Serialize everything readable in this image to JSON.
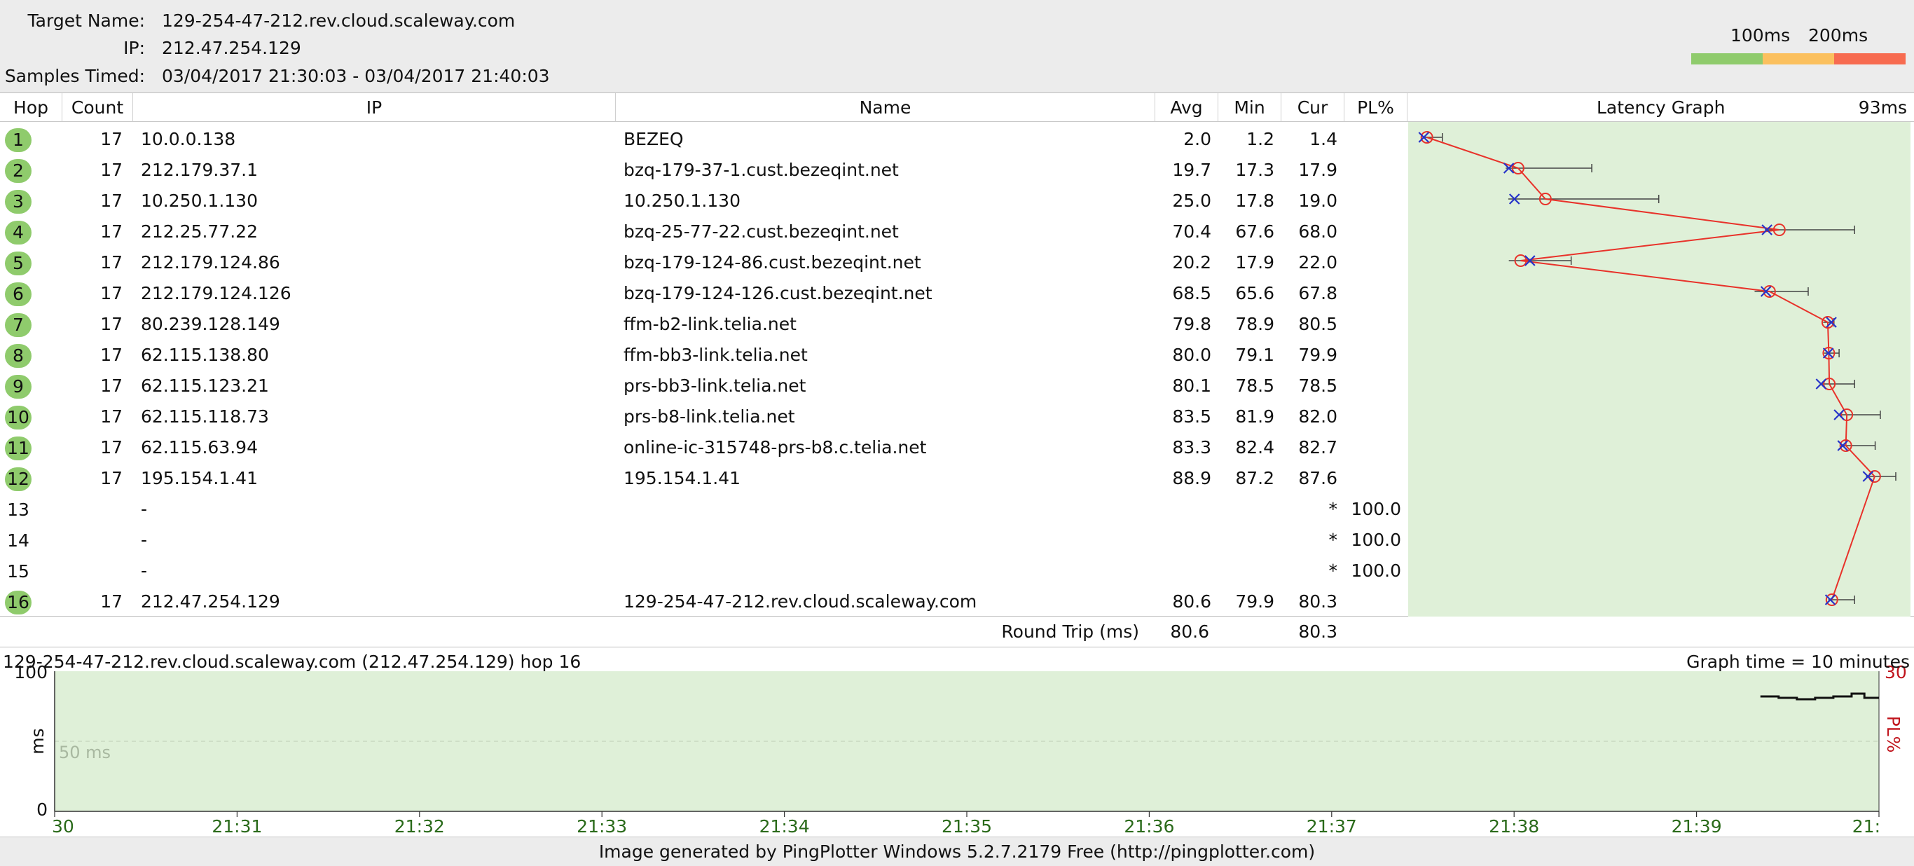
{
  "header": {
    "target_label": "Target Name:",
    "target_value": "129-254-47-212.rev.cloud.scaleway.com",
    "ip_label": "IP:",
    "ip_value": "212.47.254.129",
    "samples_label": "Samples Timed:",
    "samples_value": "03/04/2017 21:30:03 - 03/04/2017 21:40:03"
  },
  "legend": {
    "label_100": "100ms",
    "label_200": "200ms",
    "colors": [
      "#8fcb6c",
      "#fbc05e",
      "#f76b50"
    ]
  },
  "table": {
    "columns": {
      "hop": "Hop",
      "count": "Count",
      "ip": "IP",
      "name": "Name",
      "avg": "Avg",
      "min": "Min",
      "cur": "Cur",
      "pl": "PL%",
      "graph": "Latency Graph",
      "graph_scale": "93ms"
    },
    "rows": [
      {
        "hop": "1",
        "count": "17",
        "ip": "10.0.0.138",
        "name": "BEZEQ",
        "avg": "2.0",
        "min": "1.2",
        "cur": "1.4",
        "pl": "",
        "ok": true
      },
      {
        "hop": "2",
        "count": "17",
        "ip": "212.179.37.1",
        "name": "bzq-179-37-1.cust.bezeqint.net",
        "avg": "19.7",
        "min": "17.3",
        "cur": "17.9",
        "pl": "",
        "ok": true
      },
      {
        "hop": "3",
        "count": "17",
        "ip": "10.250.1.130",
        "name": "10.250.1.130",
        "avg": "25.0",
        "min": "17.8",
        "cur": "19.0",
        "pl": "",
        "ok": true
      },
      {
        "hop": "4",
        "count": "17",
        "ip": "212.25.77.22",
        "name": "bzq-25-77-22.cust.bezeqint.net",
        "avg": "70.4",
        "min": "67.6",
        "cur": "68.0",
        "pl": "",
        "ok": true
      },
      {
        "hop": "5",
        "count": "17",
        "ip": "212.179.124.86",
        "name": "bzq-179-124-86.cust.bezeqint.net",
        "avg": "20.2",
        "min": "17.9",
        "cur": "22.0",
        "pl": "",
        "ok": true
      },
      {
        "hop": "6",
        "count": "17",
        "ip": "212.179.124.126",
        "name": "bzq-179-124-126.cust.bezeqint.net",
        "avg": "68.5",
        "min": "65.6",
        "cur": "67.8",
        "pl": "",
        "ok": true
      },
      {
        "hop": "7",
        "count": "17",
        "ip": "80.239.128.149",
        "name": "ffm-b2-link.telia.net",
        "avg": "79.8",
        "min": "78.9",
        "cur": "80.5",
        "pl": "",
        "ok": true
      },
      {
        "hop": "8",
        "count": "17",
        "ip": "62.115.138.80",
        "name": "ffm-bb3-link.telia.net",
        "avg": "80.0",
        "min": "79.1",
        "cur": "79.9",
        "pl": "",
        "ok": true
      },
      {
        "hop": "9",
        "count": "17",
        "ip": "62.115.123.21",
        "name": "prs-bb3-link.telia.net",
        "avg": "80.1",
        "min": "78.5",
        "cur": "78.5",
        "pl": "",
        "ok": true
      },
      {
        "hop": "10",
        "count": "17",
        "ip": "62.115.118.73",
        "name": "prs-b8-link.telia.net",
        "avg": "83.5",
        "min": "81.9",
        "cur": "82.0",
        "pl": "",
        "ok": true
      },
      {
        "hop": "11",
        "count": "17",
        "ip": "62.115.63.94",
        "name": "online-ic-315748-prs-b8.c.telia.net",
        "avg": "83.3",
        "min": "82.4",
        "cur": "82.7",
        "pl": "",
        "ok": true
      },
      {
        "hop": "12",
        "count": "17",
        "ip": "195.154.1.41",
        "name": "195.154.1.41",
        "avg": "88.9",
        "min": "87.2",
        "cur": "87.6",
        "pl": "",
        "ok": true
      },
      {
        "hop": "13",
        "count": "",
        "ip": "-",
        "name": "",
        "avg": "",
        "min": "",
        "cur": "*",
        "pl": "100.0",
        "ok": false
      },
      {
        "hop": "14",
        "count": "",
        "ip": "-",
        "name": "",
        "avg": "",
        "min": "",
        "cur": "*",
        "pl": "100.0",
        "ok": false
      },
      {
        "hop": "15",
        "count": "",
        "ip": "-",
        "name": "",
        "avg": "",
        "min": "",
        "cur": "*",
        "pl": "100.0",
        "ok": false
      },
      {
        "hop": "16",
        "count": "17",
        "ip": "212.47.254.129",
        "name": "129-254-47-212.rev.cloud.scaleway.com",
        "avg": "80.6",
        "min": "79.9",
        "cur": "80.3",
        "pl": "",
        "ok": true
      }
    ]
  },
  "latency_graph": {
    "scale_max_ms": 93,
    "hops": [
      {
        "hop": 1,
        "avg": 2.0,
        "min": 1.2,
        "max": 5.0,
        "cur": 1.4
      },
      {
        "hop": 2,
        "avg": 19.7,
        "min": 17.3,
        "max": 34.0,
        "cur": 17.9
      },
      {
        "hop": 3,
        "avg": 25.0,
        "min": 17.8,
        "max": 47.0,
        "cur": 19.0
      },
      {
        "hop": 4,
        "avg": 70.4,
        "min": 67.6,
        "max": 85.0,
        "cur": 68.0
      },
      {
        "hop": 5,
        "avg": 20.2,
        "min": 17.9,
        "max": 30.0,
        "cur": 22.0
      },
      {
        "hop": 6,
        "avg": 68.5,
        "min": 65.6,
        "max": 76.0,
        "cur": 67.8
      },
      {
        "hop": 7,
        "avg": 79.8,
        "min": 78.9,
        "max": 81.0,
        "cur": 80.5
      },
      {
        "hop": 8,
        "avg": 80.0,
        "min": 79.1,
        "max": 82.0,
        "cur": 79.9
      },
      {
        "hop": 9,
        "avg": 80.1,
        "min": 78.5,
        "max": 85.0,
        "cur": 78.5
      },
      {
        "hop": 10,
        "avg": 83.5,
        "min": 81.9,
        "max": 90.0,
        "cur": 82.0
      },
      {
        "hop": 11,
        "avg": 83.3,
        "min": 82.4,
        "max": 89.0,
        "cur": 82.7
      },
      {
        "hop": 12,
        "avg": 88.9,
        "min": 87.2,
        "max": 93.0,
        "cur": 87.6
      },
      {
        "hop": 16,
        "avg": 80.6,
        "min": 79.9,
        "max": 85.0,
        "cur": 80.3
      }
    ]
  },
  "roundtrip": {
    "label": "Round Trip (ms)",
    "avg": "80.6",
    "cur": "80.3"
  },
  "timegraph": {
    "title": "129-254-47-212.rev.cloud.scaleway.com (212.47.254.129) hop 16",
    "graph_time": "Graph time = 10 minutes",
    "y_max": "100",
    "y_min": "0",
    "y_unit": "ms",
    "mid_label": "50 ms",
    "pl_max": "30",
    "pl_label": "PL%",
    "x_ticks": [
      "30",
      "21:31",
      "21:32",
      "21:33",
      "21:34",
      "21:35",
      "21:36",
      "21:37",
      "21:38",
      "21:39",
      "21:"
    ],
    "series_ms": [
      {
        "t": 9.35,
        "v": 82
      },
      {
        "t": 9.45,
        "v": 81
      },
      {
        "t": 9.55,
        "v": 80
      },
      {
        "t": 9.65,
        "v": 81
      },
      {
        "t": 9.75,
        "v": 82
      },
      {
        "t": 9.85,
        "v": 84
      },
      {
        "t": 9.92,
        "v": 81
      },
      {
        "t": 10.0,
        "v": 81
      }
    ]
  },
  "footer": {
    "text": "Image generated by PingPlotter Windows 5.2.7.2179 Free (http://pingplotter.com)"
  }
}
